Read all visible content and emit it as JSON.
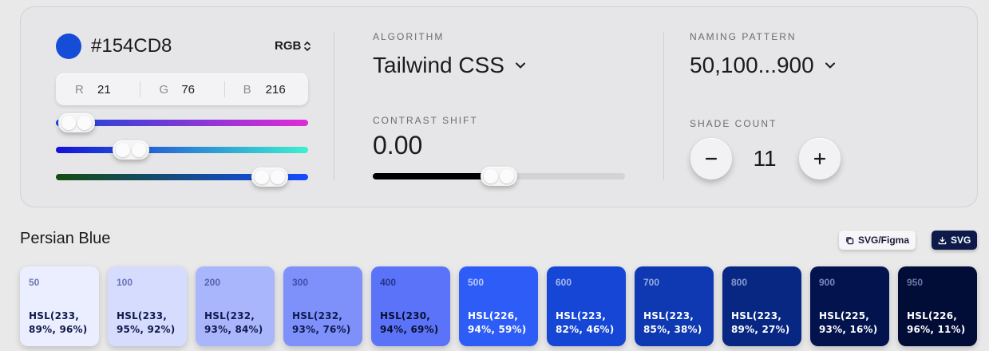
{
  "color": {
    "hex": "#154CD8",
    "swatch": "#154CD8",
    "mode": "RGB",
    "r_label": "R",
    "r_value": "21",
    "g_label": "G",
    "g_value": "76",
    "b_label": "B",
    "b_value": "216",
    "sliders": [
      {
        "name": "red",
        "value": 21,
        "max": 255,
        "gradient": [
          "#1446d8",
          "#e02bd6"
        ]
      },
      {
        "name": "green",
        "value": 76,
        "max": 255,
        "gradient": [
          "#1510d8",
          "#3ef0d0"
        ]
      },
      {
        "name": "blue",
        "value": 216,
        "max": 255,
        "gradient": [
          "#154c10",
          "#154cff"
        ]
      }
    ]
  },
  "algorithm": {
    "label": "ALGORITHM",
    "value": "Tailwind CSS"
  },
  "contrast": {
    "label": "CONTRAST SHIFT",
    "value": "0.00",
    "level": 0.5
  },
  "naming": {
    "label": "NAMING PATTERN",
    "value": "50,100...900"
  },
  "shade_count": {
    "label": "SHADE COUNT",
    "value": "11",
    "minus_icon": "minus-icon",
    "plus_icon": "plus-icon"
  },
  "palette": {
    "name": "Persian Blue",
    "export_figma": "SVG/Figma",
    "export_svg": "SVG",
    "shades": [
      {
        "step": "50",
        "hsl": "HSL(233,\n89%, 96%)",
        "bg": "#ebeefe",
        "step_color": "#6f78b3",
        "text_color": "#0f1a4d"
      },
      {
        "step": "100",
        "hsl": "HSL(233,\n95%, 92%)",
        "bg": "#d6dcfe",
        "step_color": "#6873b5",
        "text_color": "#0f1a4d"
      },
      {
        "step": "200",
        "hsl": "HSL(232,\n93%, 84%)",
        "bg": "#a9b6fc",
        "step_color": "#5663b4",
        "text_color": "#0f1a4d"
      },
      {
        "step": "300",
        "hsl": "HSL(232,\n93%, 76%)",
        "bg": "#7e90fa",
        "step_color": "#3f4eaa",
        "text_color": "#0f1a4d"
      },
      {
        "step": "400",
        "hsl": "HSL(230,\n94%, 69%)",
        "bg": "#5b73f8",
        "step_color": "#25338e",
        "text_color": "#0a1030"
      },
      {
        "step": "500",
        "hsl": "HSL(226,\n94%, 59%)",
        "bg": "#2d5df6",
        "step_color": "#b9c8ff",
        "text_color": "#ffffff"
      },
      {
        "step": "600",
        "hsl": "HSL(223,\n82%, 46%)",
        "bg": "#1546d5",
        "step_color": "#a7b8ef",
        "text_color": "#ffffff"
      },
      {
        "step": "700",
        "hsl": "HSL(223,\n85%, 38%)",
        "bg": "#0e39b3",
        "step_color": "#9aaae0",
        "text_color": "#ffffff"
      },
      {
        "step": "800",
        "hsl": "HSL(223,\n89%, 27%)",
        "bg": "#072783",
        "step_color": "#8b9ad0",
        "text_color": "#ffffff"
      },
      {
        "step": "900",
        "hsl": "HSL(225,\n93%, 16%)",
        "bg": "#03134e",
        "step_color": "#7a86bd",
        "text_color": "#ffffff"
      },
      {
        "step": "950",
        "hsl": "HSL(226,\n96%, 11%)",
        "bg": "#010c37",
        "step_color": "#6c77ab",
        "text_color": "#ffffff"
      }
    ]
  }
}
